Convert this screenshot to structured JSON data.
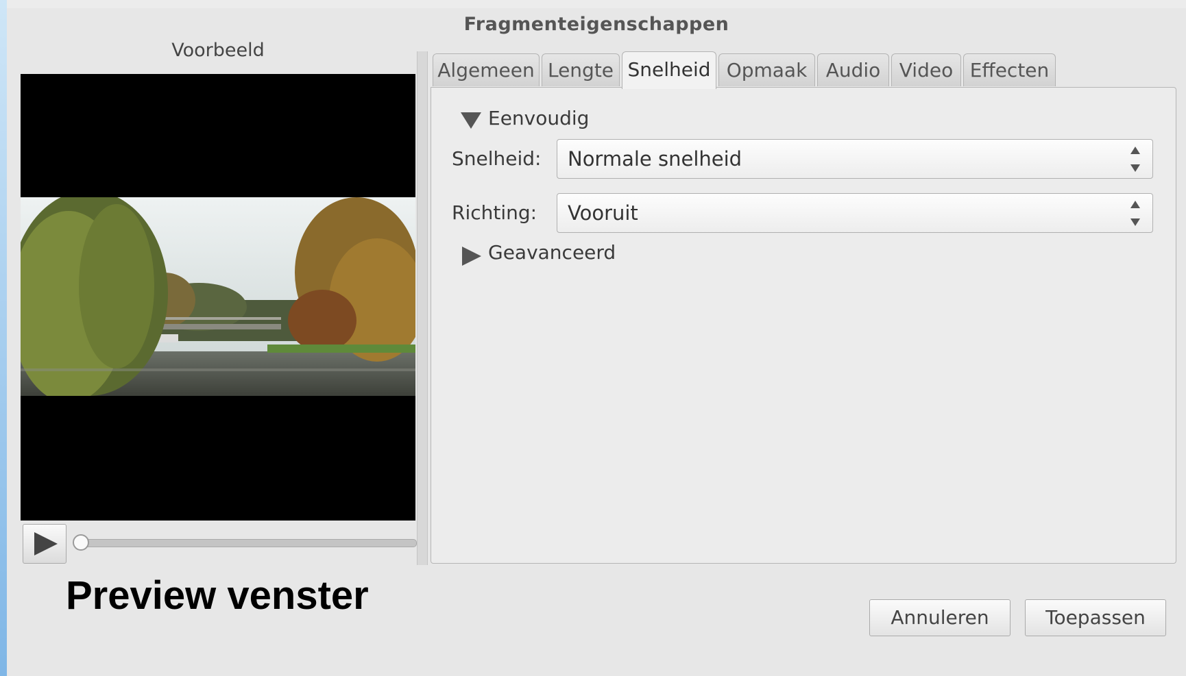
{
  "dialog": {
    "title": "Fragmenteigenschappen"
  },
  "preview": {
    "label": "Voorbeeld",
    "play_icon": "play-icon",
    "seek_position": 0
  },
  "caption": "Preview venster",
  "tabs": [
    {
      "label": "Algemeen",
      "active": false
    },
    {
      "label": "Lengte",
      "active": false
    },
    {
      "label": "Snelheid",
      "active": true
    },
    {
      "label": "Opmaak",
      "active": false
    },
    {
      "label": "Audio",
      "active": false
    },
    {
      "label": "Video",
      "active": false
    },
    {
      "label": "Effecten",
      "active": false
    }
  ],
  "panel": {
    "simple": {
      "label": "Eenvoudig",
      "expanded": true
    },
    "speed": {
      "label": "Snelheid:",
      "value": "Normale snelheid"
    },
    "direction": {
      "label": "Richting:",
      "value": "Vooruit"
    },
    "advanced": {
      "label": "Geavanceerd",
      "expanded": false
    }
  },
  "buttons": {
    "cancel": "Annuleren",
    "apply": "Toepassen"
  }
}
